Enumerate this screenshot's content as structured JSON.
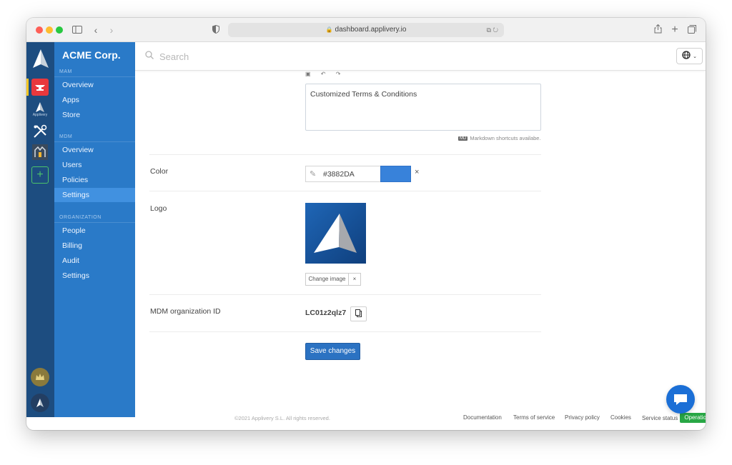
{
  "browser": {
    "url": "dashboard.applivery.io"
  },
  "rail": {
    "applivery_label": "Applivery"
  },
  "nav": {
    "org_name": "ACME Corp.",
    "mam_label": "MAM",
    "mam_items": [
      {
        "label": "Overview"
      },
      {
        "label": "Apps"
      },
      {
        "label": "Store"
      }
    ],
    "mdm_label": "MDM",
    "mdm_items": [
      {
        "label": "Overview"
      },
      {
        "label": "Users"
      },
      {
        "label": "Policies"
      },
      {
        "label": "Settings",
        "active": true
      }
    ],
    "org_label": "ORGANIZATION",
    "org_items": [
      {
        "label": "People"
      },
      {
        "label": "Billing"
      },
      {
        "label": "Audit"
      },
      {
        "label": "Settings"
      }
    ]
  },
  "search": {
    "placeholder": "Search"
  },
  "form": {
    "terms_text": "Customized Terms & Conditions",
    "markdown_badge": "MD",
    "markdown_hint": "Markdown shortcuts availabe.",
    "color_label": "Color",
    "color_value": "#3882DA",
    "color_clear": "×",
    "logo_label": "Logo",
    "change_image_label": "Change image",
    "remove_image_label": "×",
    "org_id_label": "MDM organization ID",
    "org_id_value": "LC01z2qlz7",
    "save_label": "Save changes"
  },
  "footer": {
    "copyright": "©2021 Applivery S.L. All rights reserved.",
    "links": [
      "Documentation",
      "Terms of service",
      "Privacy policy",
      "Cookies",
      "Service status"
    ],
    "status": "Operational"
  },
  "colors": {
    "accent": "#2b72c2",
    "swatch": "#3882DA",
    "status_green": "#28a745",
    "nav_bg": "#2a7ac8",
    "rail_bg": "#1d4d80"
  }
}
